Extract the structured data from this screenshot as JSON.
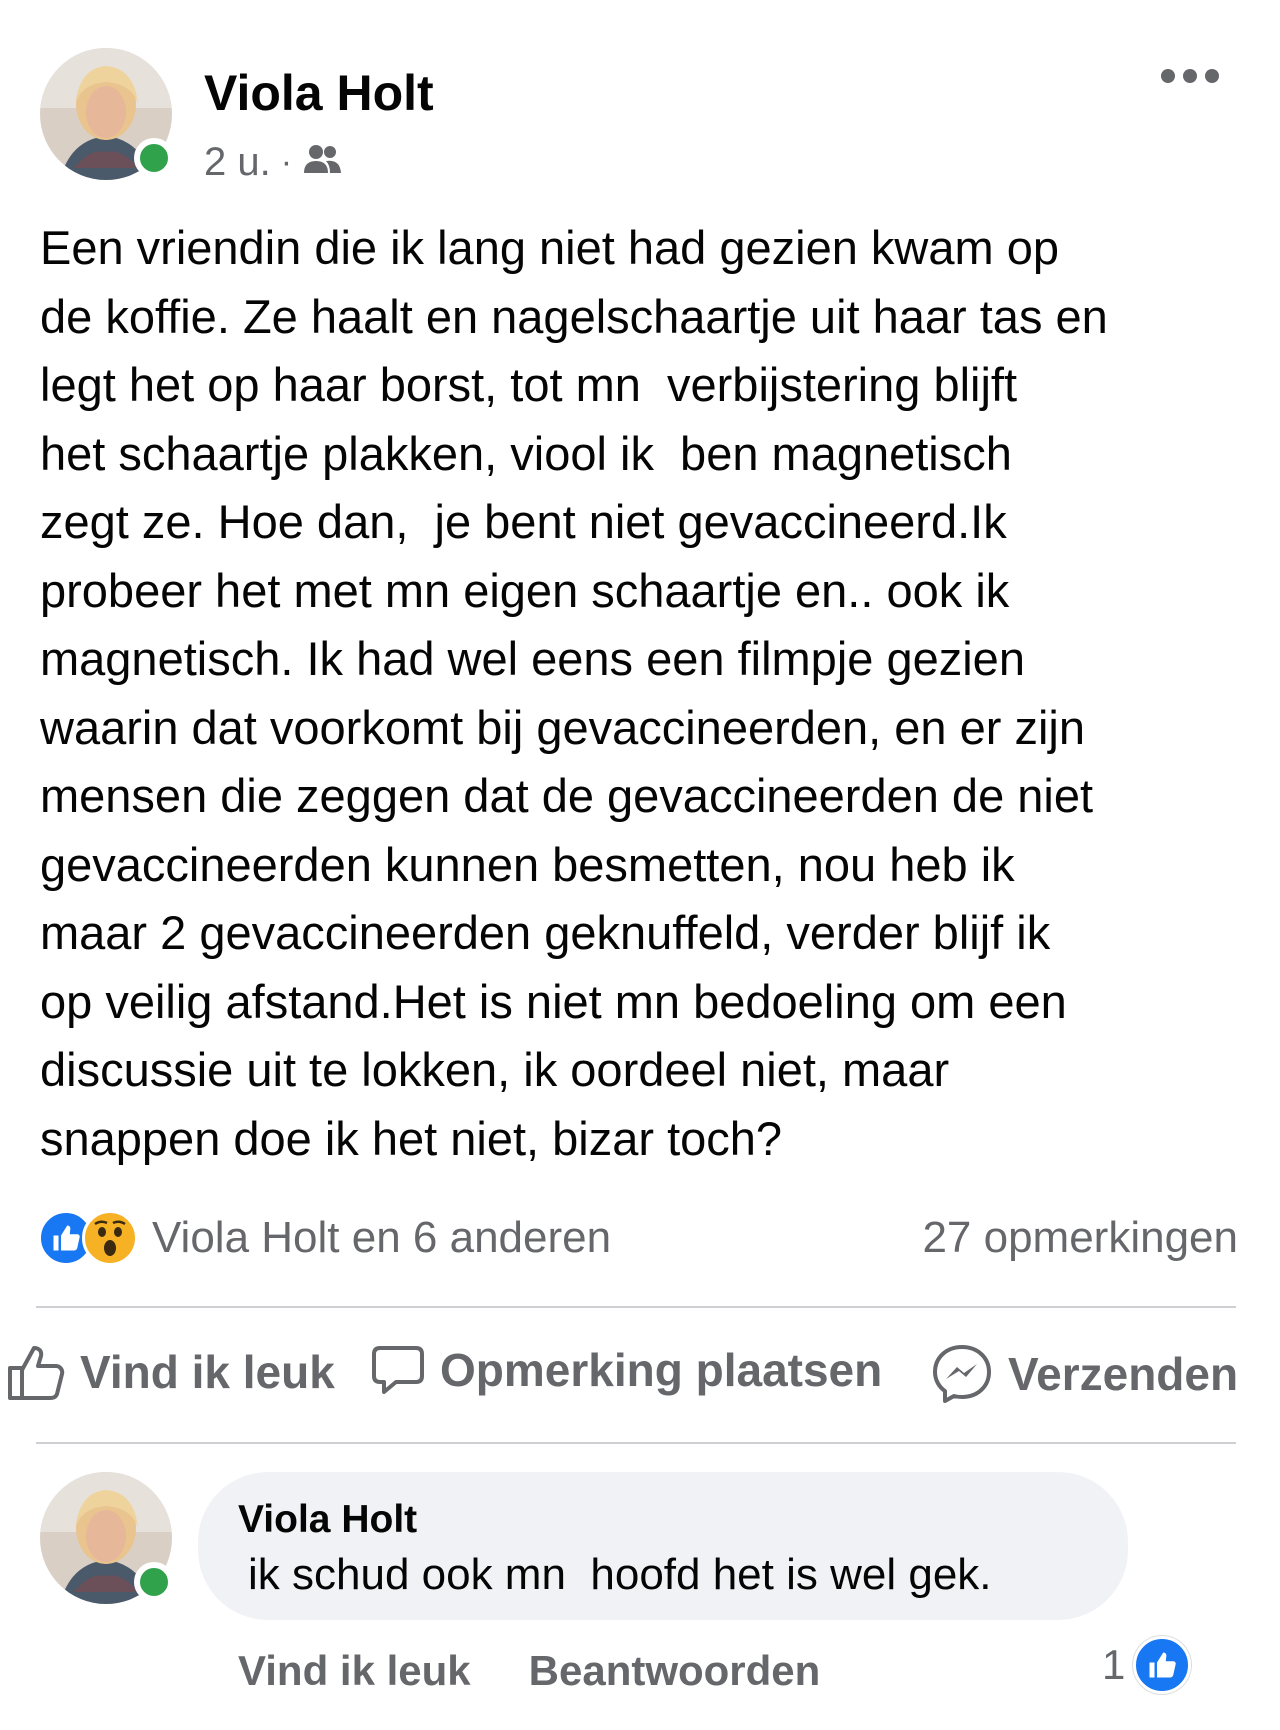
{
  "post": {
    "author": "Viola Holt",
    "time": "2 u.",
    "meta_separator": "·",
    "audience_icon": "friends-icon",
    "online": true,
    "more_icon": "more-options-icon",
    "lines": [
      "Een vriendin die ik lang niet had gezien kwam op",
      "de koffie. Ze haalt en nagelschaartje uit haar tas en",
      "legt het op haar borst, tot mn  verbijstering blijft",
      "het schaartje plakken, viool ik  ben magnetisch",
      "zegt ze. Hoe dan,  je bent niet gevaccineerd.Ik",
      "probeer het met mn eigen schaartje en.. ook ik",
      "magnetisch. Ik had wel eens een filmpje gezien",
      "waarin dat voorkomt bij gevaccineerden, en er zijn",
      "mensen die zeggen dat de gevaccineerden de niet",
      "gevaccineerden kunnen besmetten, nou heb ik",
      "maar 2 gevaccineerden geknuffeld, verder blijf ik",
      "op veilig afstand.Het is niet mn bedoeling om een",
      "discussie uit te lokken, ik oordeel niet, maar",
      "snappen doe ik het niet, bizar toch?"
    ]
  },
  "reactions": {
    "icons": [
      "like-reaction-icon",
      "wow-reaction-icon"
    ],
    "summary": "Viola Holt en 6 anderen",
    "comments_count": "27 opmerkingen"
  },
  "actions": {
    "like": "Vind ik leuk",
    "comment": "Opmerking plaatsen",
    "share": "Verzenden"
  },
  "comment": {
    "author": "Viola Holt",
    "text": "ik schud ook mn  hoofd het is wel gek.",
    "like_label": "Vind ik leuk",
    "reply_label": "Beantwoorden",
    "like_count": "1"
  },
  "colors": {
    "like_blue": "#1877f2",
    "wow_yellow": "#f7b125",
    "online_green": "#31a24c",
    "secondary_text": "#65676b"
  }
}
